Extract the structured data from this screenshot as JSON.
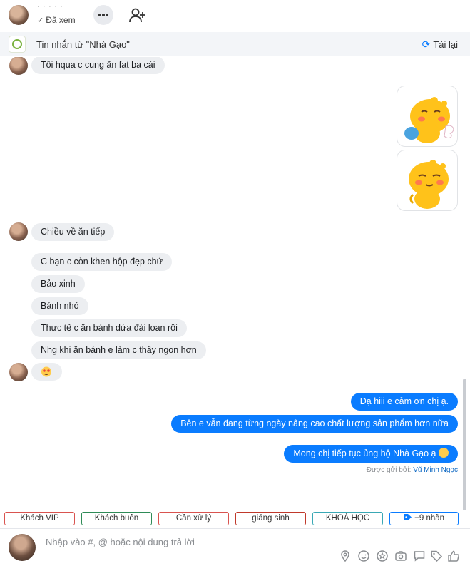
{
  "header": {
    "name": "· · · · ·",
    "seen_label": "Đã xem"
  },
  "notice": {
    "text": "Tin nhắn từ  \"Nhà Gạo\"",
    "reload_label": "Tải lại"
  },
  "messages": {
    "m1": "Tối hqua c cung ăn fat ba cái",
    "m2": "Chiều về ăn tiếp",
    "m3": "C bạn c còn khen hộp đẹp chứ",
    "m4": "Bảo xinh",
    "m5": "Bánh nhỏ",
    "m6": "Thưc tế c ăn bánh dứa đài loan rồi",
    "m7": "Nhg khi ăn bánh e làm c thấy ngon hơn",
    "r1": "Dạ hiii e cảm ơn chị ạ.",
    "r2": "Bên e vẫn đang từng ngày nâng cao chất lượng sản phẩm hơn nữa",
    "r3": "Mong chị tiếp tục ủng hộ Nhà Gạo ạ"
  },
  "sent_by": {
    "prefix": "Được gửi bởi:",
    "name": "Vũ Minh Ngọc"
  },
  "tags": [
    {
      "label": "Khách VIP",
      "color": "#d9534f"
    },
    {
      "label": "Khách buôn",
      "color": "#2e8b57"
    },
    {
      "label": "Cần xử lý",
      "color": "#d9534f"
    },
    {
      "label": "giáng sinh",
      "color": "#c0392b"
    },
    {
      "label": "KHOÁ HỌC",
      "color": "#3aa8b5"
    },
    {
      "label": "+9 nhãn",
      "color": "#0a7cff"
    }
  ],
  "composer": {
    "placeholder": "Nhập vào #, @ hoặc nội dung trả lời"
  },
  "colors": {
    "accent": "#0a7cff",
    "bubble_in": "#eceef1",
    "sticker_yellow": "#ffc21a"
  }
}
